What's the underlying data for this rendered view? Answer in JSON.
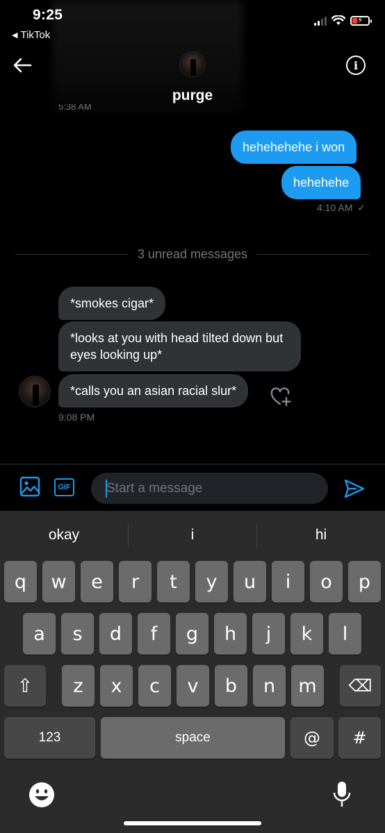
{
  "status_bar": {
    "time": "9:25",
    "back_app": "TikTok",
    "back_glyph": "◀"
  },
  "header": {
    "title": "purge",
    "info_glyph": "i",
    "partial_timestamp": "5:38 AM"
  },
  "outgoing": [
    {
      "text": "hehehehehe i won"
    },
    {
      "text": "hehehehe"
    }
  ],
  "outgoing_time": "4:10 AM",
  "read_mark": "✓",
  "divider_text": "3 unread messages",
  "incoming": [
    {
      "text": "*smokes cigar*"
    },
    {
      "text": "*looks at you with head tilted down but eyes looking up*"
    },
    {
      "text": "*calls you an asian racial slur*"
    }
  ],
  "incoming_time": "9:08 PM",
  "composer": {
    "gif_label": "GIF",
    "placeholder": "Start a message"
  },
  "keyboard": {
    "suggestions": [
      "okay",
      "i",
      "hi"
    ],
    "row1": [
      "q",
      "w",
      "e",
      "r",
      "t",
      "y",
      "u",
      "i",
      "o",
      "p"
    ],
    "row2": [
      "a",
      "s",
      "d",
      "f",
      "g",
      "h",
      "j",
      "k",
      "l"
    ],
    "row3": [
      "z",
      "x",
      "c",
      "v",
      "b",
      "n",
      "m"
    ],
    "shift_glyph": "⇧",
    "delete_glyph": "⌫",
    "numbers_label": "123",
    "space_label": "space",
    "at_label": "@",
    "hash_label": "#"
  },
  "colors": {
    "accent": "#1d9bf0",
    "incoming_bubble": "#2f3336",
    "muted": "#71767b",
    "battery_low": "#ff3b30"
  },
  "icons": [
    "back-arrow-icon",
    "info-icon",
    "media-icon",
    "gif-icon",
    "send-icon",
    "heart-add-icon",
    "emoji-icon",
    "mic-icon",
    "wifi-icon",
    "battery-icon"
  ]
}
